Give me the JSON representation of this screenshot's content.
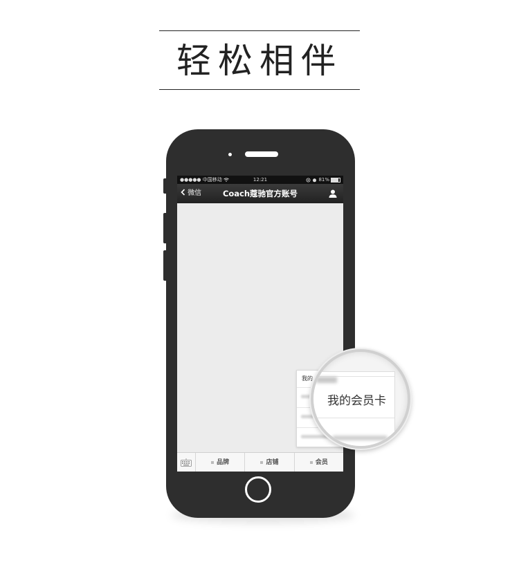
{
  "heading": "轻松相伴",
  "status_bar": {
    "carrier": "●●●●● 中国移动",
    "time": "12:21",
    "battery": "81%",
    "battery_level": 0.81
  },
  "nav": {
    "back_label": "微信",
    "title": "Coach蔻驰官方账号"
  },
  "popup": {
    "head": "我的",
    "first_item": "我的会员卡"
  },
  "menu": {
    "items": [
      "品牌",
      "店铺",
      "会员"
    ]
  },
  "colors": {
    "phone_body": "#2e2e2e",
    "screen_bg": "#ececec",
    "nav_bg": "#2a2a2a"
  },
  "icons": [
    "chevron-left-icon",
    "wifi-icon",
    "alarm-icon",
    "battery-icon",
    "user-icon",
    "keyboard-icon"
  ]
}
